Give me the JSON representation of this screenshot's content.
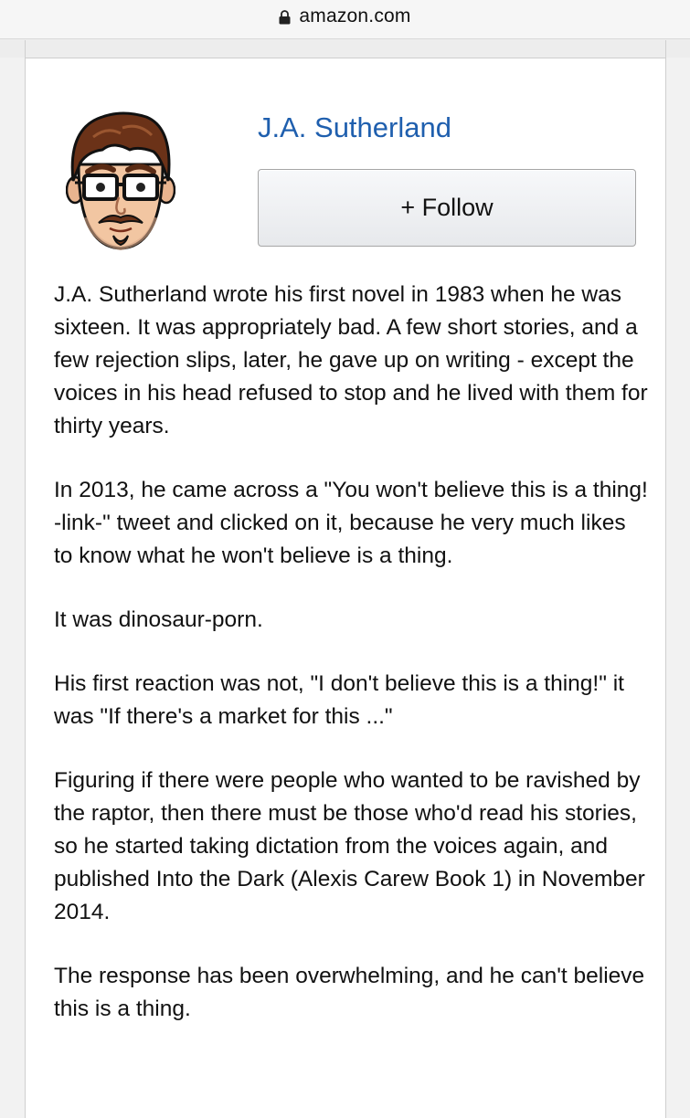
{
  "browser": {
    "url": "amazon.com"
  },
  "author": {
    "name": "J.A. Sutherland",
    "follow_label": "+ Follow"
  },
  "bio": {
    "paragraphs": [
      "J.A. Sutherland wrote his first novel in 1983 when he was sixteen. It was appropriately bad. A few short stories, and a few rejection slips, later, he gave up on writing - except the voices in his head refused to stop and he lived with them for thirty years.",
      "In 2013, he came across a \"You won't believe this is a thing! -link-\" tweet and clicked on it, because he very much likes to know what he won't believe is a thing.",
      "It was dinosaur-porn.",
      "His first reaction was not, \"I don't believe this is a thing!\" it was \"If there's a market for this ...\"",
      "Figuring if there were people who wanted to be ravished by the raptor, then there must be those who'd read his stories, so he started taking dictation from the voices again, and published Into the Dark (Alexis Carew Book 1) in November 2014.",
      "The response has been overwhelming, and he can't believe this is a thing."
    ]
  },
  "colors": {
    "link": "#1f5fae",
    "button_border": "#a6a6a6"
  },
  "icons": {
    "lock": "lock-icon",
    "avatar": "cartoon-author-avatar"
  }
}
